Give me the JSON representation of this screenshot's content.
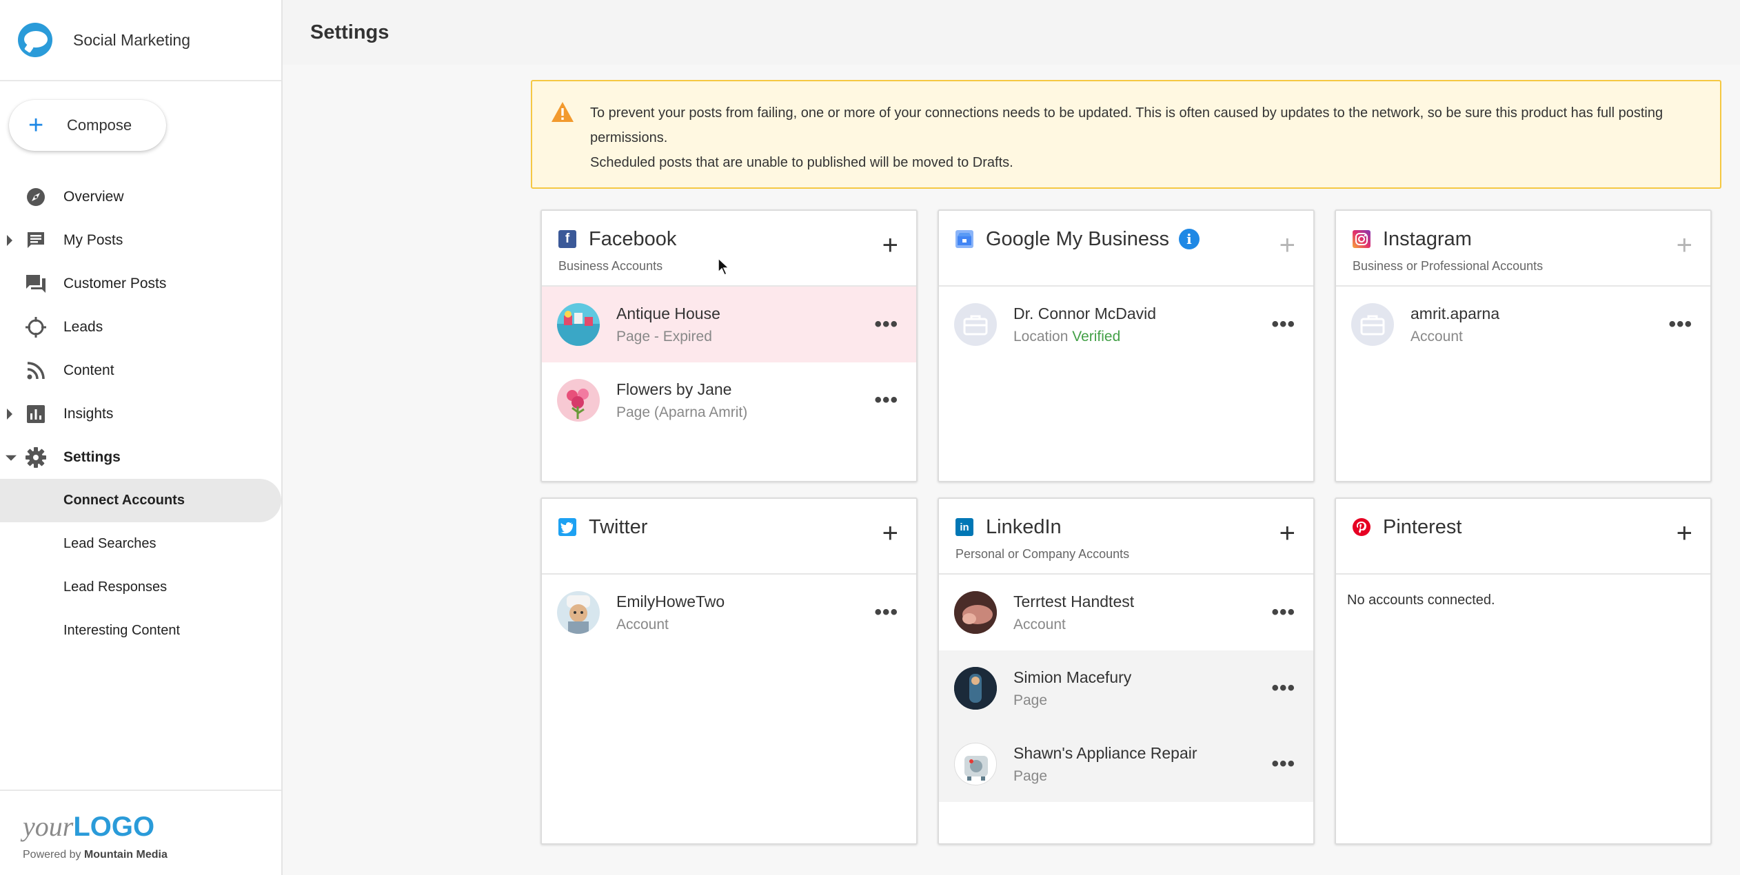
{
  "app": {
    "name": "Social Marketing"
  },
  "compose": {
    "label": "Compose"
  },
  "nav": {
    "overview": "Overview",
    "my_posts": "My Posts",
    "customer_posts": "Customer Posts",
    "leads": "Leads",
    "content": "Content",
    "insights": "Insights",
    "settings": "Settings",
    "sub": {
      "connect_accounts": "Connect Accounts",
      "lead_searches": "Lead Searches",
      "lead_responses": "Lead Responses",
      "interesting_content": "Interesting Content"
    }
  },
  "footer": {
    "logo_your": "your",
    "logo_logo": "LOGO",
    "powered_by": "Powered by",
    "company": "Mountain Media"
  },
  "header": {
    "title": "Settings"
  },
  "alert": {
    "line1": "To prevent your posts from failing, one or more of your connections needs to be updated. This is often caused by updates to the network, so be sure this product has full posting permissions.",
    "line2": "Scheduled posts that are unable to published will be moved to Drafts."
  },
  "colors": {
    "facebook": "#3b5998",
    "google": "#4285f4",
    "instagram": "#c13584",
    "twitter": "#1da1f2",
    "linkedin": "#0077b5",
    "pinterest": "#e60023",
    "alert_border": "#f5c842",
    "verified": "#43a047"
  },
  "cards": {
    "facebook": {
      "title": "Facebook",
      "subtitle": "Business Accounts",
      "icon": "facebook-icon",
      "accounts": [
        {
          "name": "Antique House",
          "sub": "Page - Expired"
        },
        {
          "name": "Flowers by Jane",
          "sub": "Page (Aparna Amrit)"
        }
      ]
    },
    "google": {
      "title": "Google My Business",
      "icon": "google-my-business-icon",
      "accounts": [
        {
          "name": "Dr. Connor McDavid",
          "sub_prefix": "Location",
          "sub_status": "Verified"
        }
      ]
    },
    "instagram": {
      "title": "Instagram",
      "subtitle": "Business or Professional Accounts",
      "icon": "instagram-icon",
      "accounts": [
        {
          "name": "amrit.aparna",
          "sub": "Account"
        }
      ]
    },
    "twitter": {
      "title": "Twitter",
      "icon": "twitter-icon",
      "accounts": [
        {
          "name": "EmilyHoweTwo",
          "sub": "Account"
        }
      ]
    },
    "linkedin": {
      "title": "LinkedIn",
      "subtitle": "Personal or Company Accounts",
      "icon": "linkedin-icon",
      "accounts": [
        {
          "name": "Terrtest Handtest",
          "sub": "Account"
        },
        {
          "name": "Simion Macefury",
          "sub": "Page"
        },
        {
          "name": "Shawn's Appliance Repair",
          "sub": "Page"
        }
      ]
    },
    "pinterest": {
      "title": "Pinterest",
      "icon": "pinterest-icon",
      "empty": "No accounts connected."
    }
  }
}
